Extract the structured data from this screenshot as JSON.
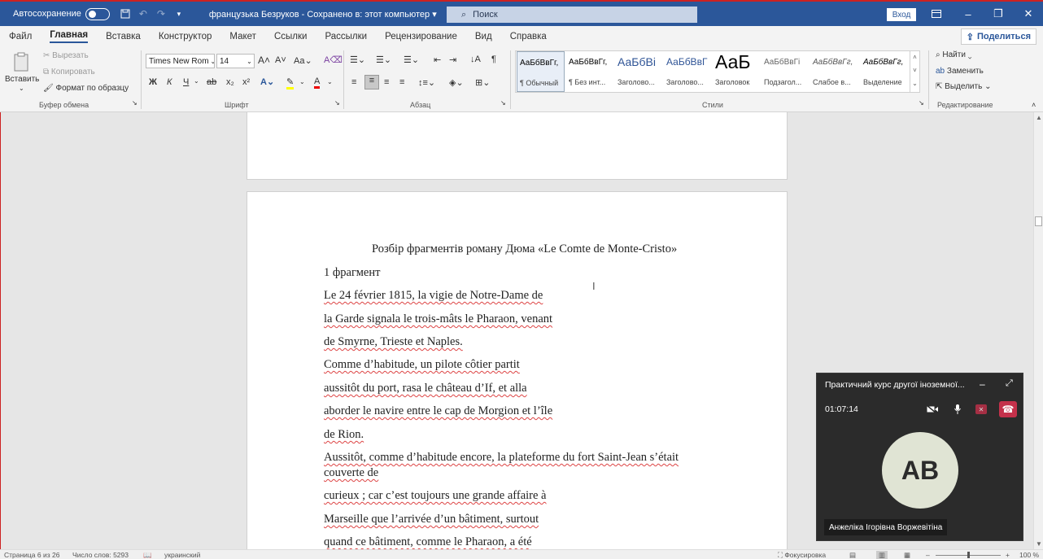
{
  "titlebar": {
    "autosave_label": "Автосохранение",
    "doc_title": "французька Безруков - Сохранено в: этот компьютер",
    "search_placeholder": "Поиск",
    "signin_label": "Вход"
  },
  "menu": {
    "items": [
      "Файл",
      "Главная",
      "Вставка",
      "Конструктор",
      "Макет",
      "Ссылки",
      "Рассылки",
      "Рецензирование",
      "Вид",
      "Справка"
    ],
    "active": "Главная",
    "share_label": "Поделиться"
  },
  "ribbon": {
    "clipboard": {
      "paste": "Вставить",
      "cut": "Вырезать",
      "copy": "Копировать",
      "format_painter": "Формат по образцу",
      "label": "Буфер обмена"
    },
    "font": {
      "family": "Times New Rom",
      "size": "14",
      "label": "Шрифт",
      "bold": "Ж",
      "italic": "К",
      "underline": "Ч"
    },
    "paragraph": {
      "label": "Абзац"
    },
    "styles": {
      "label": "Стили",
      "items": [
        {
          "sample": "АаБбВвГг,",
          "name": "¶ Обычный"
        },
        {
          "sample": "АаБбВвГг,",
          "name": "¶ Без инт..."
        },
        {
          "sample": "АаБбВі",
          "name": "Заголово..."
        },
        {
          "sample": "АаБбВвГ",
          "name": "Заголово..."
        },
        {
          "sample": "АаБ",
          "name": "Заголовок"
        },
        {
          "sample": "АаБбВвГі",
          "name": "Подзагол..."
        },
        {
          "sample": "АаБбВвГг,",
          "name": "Слабое в..."
        },
        {
          "sample": "АаБбВвГг,",
          "name": "Выделение"
        }
      ]
    },
    "editing": {
      "find": "Найти",
      "replace": "Заменить",
      "select": "Выделить",
      "label": "Редактирование"
    }
  },
  "document": {
    "title": "Розбір фрагментів роману Дюма «Le Comte de Monte-Cristo»",
    "lines": [
      "1 фрагмент",
      "Le 24 février 1815, la vigie de Notre-Dame de",
      "la Garde signala le trois-mâts le Pharaon, venant",
      "de Smyrne, Trieste et Naples.",
      "Comme d’habitude, un pilote côtier partit",
      "aussitôt du port, rasa le château d’If, et alla",
      "aborder le navire entre le cap de Morgion et l’île",
      "de Rion.",
      "Aussitôt, comme d’habitude encore, la plateforme du fort Saint-Jean s’était",
      "couverte de",
      "curieux ; car c’est toujours une grande affaire à",
      "Marseille que l’arrivée d’un bâtiment, surtout",
      "quand ce bâtiment, comme le Pharaon, a été"
    ]
  },
  "call": {
    "title": "Практичний курс другої іноземної...",
    "duration": "01:07:14",
    "initials": "AB",
    "participant": "Анжеліка Ігорівна Воржевітіна"
  },
  "statusbar": {
    "page": "Страница 6 из 26",
    "words": "Число слов: 5293",
    "language": "украинский",
    "focus": "Фокусировка",
    "zoom": "100 %"
  }
}
